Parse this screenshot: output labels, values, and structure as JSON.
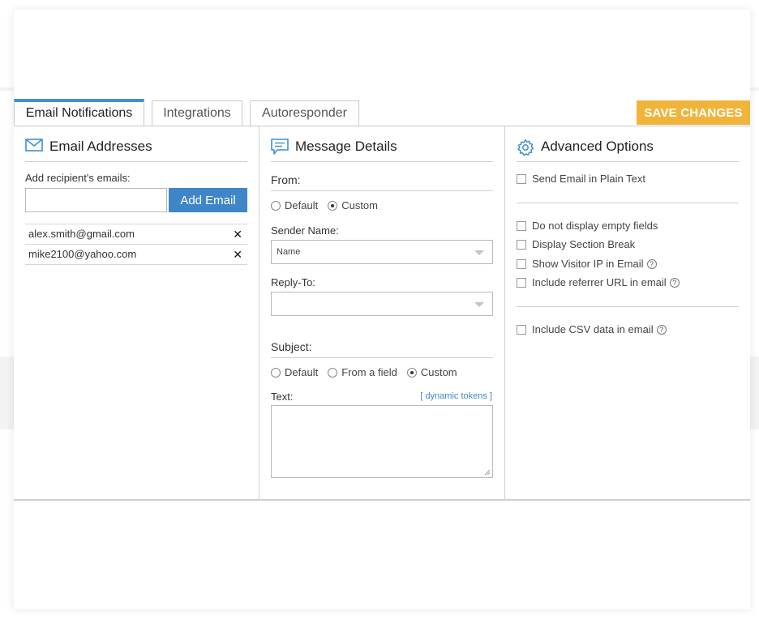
{
  "tabs": [
    {
      "label": "Email Notifications",
      "active": true
    },
    {
      "label": "Integrations",
      "active": false
    },
    {
      "label": "Autoresponder",
      "active": false
    }
  ],
  "save_label": "SAVE CHANGES",
  "email_addresses": {
    "heading": "Email Addresses",
    "add_label": "Add recipient's emails:",
    "input_value": "",
    "add_button": "Add Email",
    "recipients": [
      "alex.smith@gmail.com",
      "mike2100@yahoo.com"
    ],
    "remove_glyph": "✕"
  },
  "message_details": {
    "heading": "Message Details",
    "from_label": "From:",
    "from_options": [
      {
        "label": "Default",
        "selected": false
      },
      {
        "label": "Custom",
        "selected": true
      }
    ],
    "sender_label": "Sender Name:",
    "sender_value": "Name",
    "reply_label": "Reply-To:",
    "reply_value": "",
    "subject_label": "Subject:",
    "subject_options": [
      {
        "label": "Default",
        "selected": false
      },
      {
        "label": "From a field",
        "selected": false
      },
      {
        "label": "Custom",
        "selected": true
      }
    ],
    "text_label": "Text:",
    "tokens_link": "[ dynamic tokens ]",
    "text_value": ""
  },
  "advanced_options": {
    "heading": "Advanced Options",
    "groups": [
      [
        {
          "label": "Send Email in Plain Text",
          "help": false,
          "checked": false
        }
      ],
      [
        {
          "label": "Do not display empty fields",
          "help": false,
          "checked": false
        },
        {
          "label": "Display Section Break",
          "help": false,
          "checked": false
        },
        {
          "label": "Show Visitor IP in Email",
          "help": true,
          "checked": false
        },
        {
          "label": "Include referrer URL in email",
          "help": true,
          "checked": false
        }
      ],
      [
        {
          "label": "Include CSV data in email",
          "help": true,
          "checked": false
        }
      ]
    ],
    "help_glyph": "?"
  },
  "colors": {
    "accent_blue": "#3f86c9",
    "save_orange": "#f1b43a",
    "border": "#c9c9c9"
  }
}
